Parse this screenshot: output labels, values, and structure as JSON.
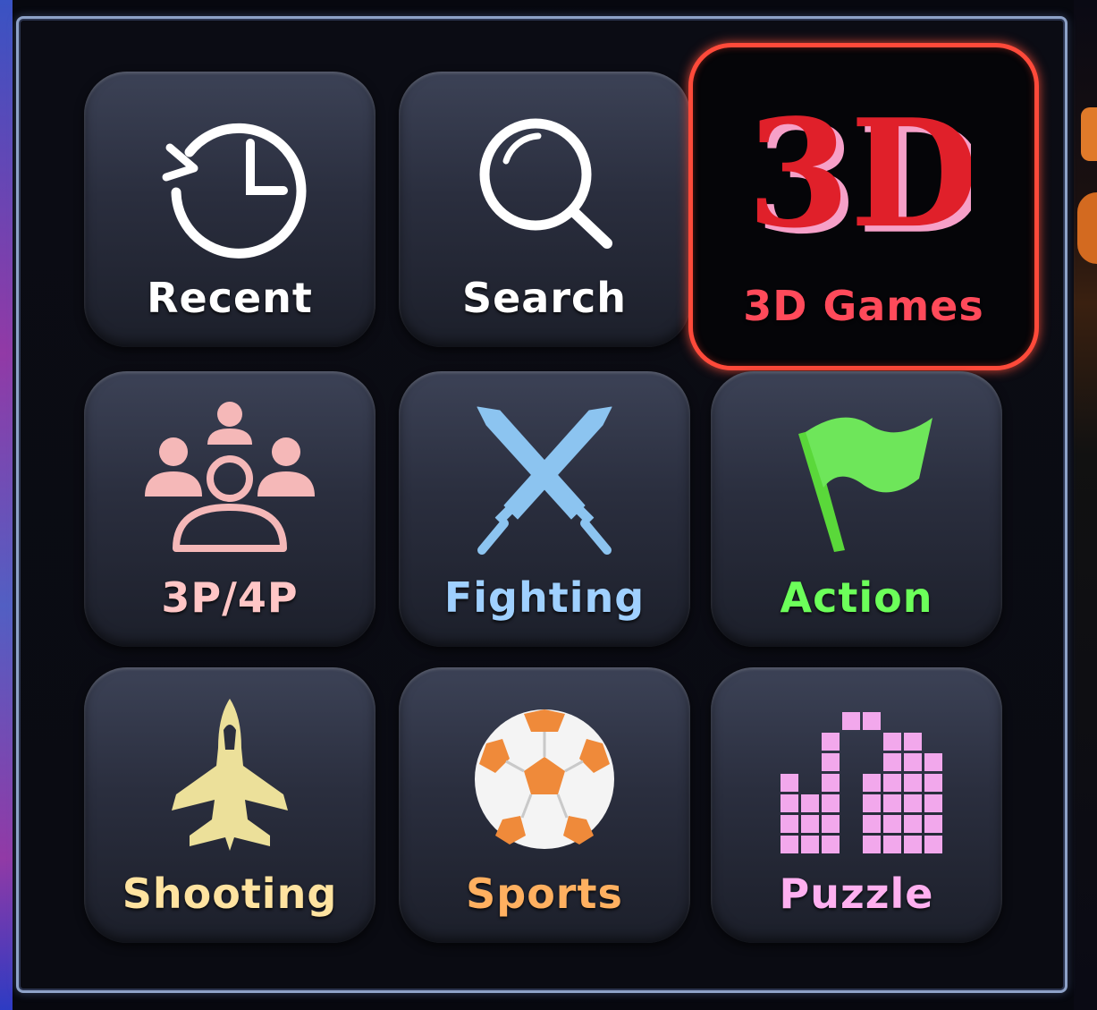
{
  "menu": {
    "tiles": [
      {
        "label": "Recent",
        "icon": "clock-history-icon",
        "color": "#ffffff",
        "selected": false
      },
      {
        "label": "Search",
        "icon": "magnifier-icon",
        "color": "#ffffff",
        "selected": false
      },
      {
        "label": "3D Games",
        "icon": "3d-text-icon",
        "color": "#ff4a5a",
        "selected": true
      },
      {
        "label": "3P/4P",
        "icon": "group-people-icon",
        "color": "#ffc6c6",
        "selected": false
      },
      {
        "label": "Fighting",
        "icon": "crossed-swords-icon",
        "color": "#9fd0ff",
        "selected": false
      },
      {
        "label": "Action",
        "icon": "green-flag-icon",
        "color": "#6cff5a",
        "selected": false
      },
      {
        "label": "Shooting",
        "icon": "jet-fighter-icon",
        "color": "#ffe3a0",
        "selected": false
      },
      {
        "label": "Sports",
        "icon": "soccer-ball-icon",
        "color": "#ffb060",
        "selected": false
      },
      {
        "label": "Puzzle",
        "icon": "tetris-blocks-icon",
        "color": "#ffb0f0",
        "selected": false
      }
    ],
    "icon_3d_text": "3D",
    "selection_color": "#ff4a3a"
  }
}
